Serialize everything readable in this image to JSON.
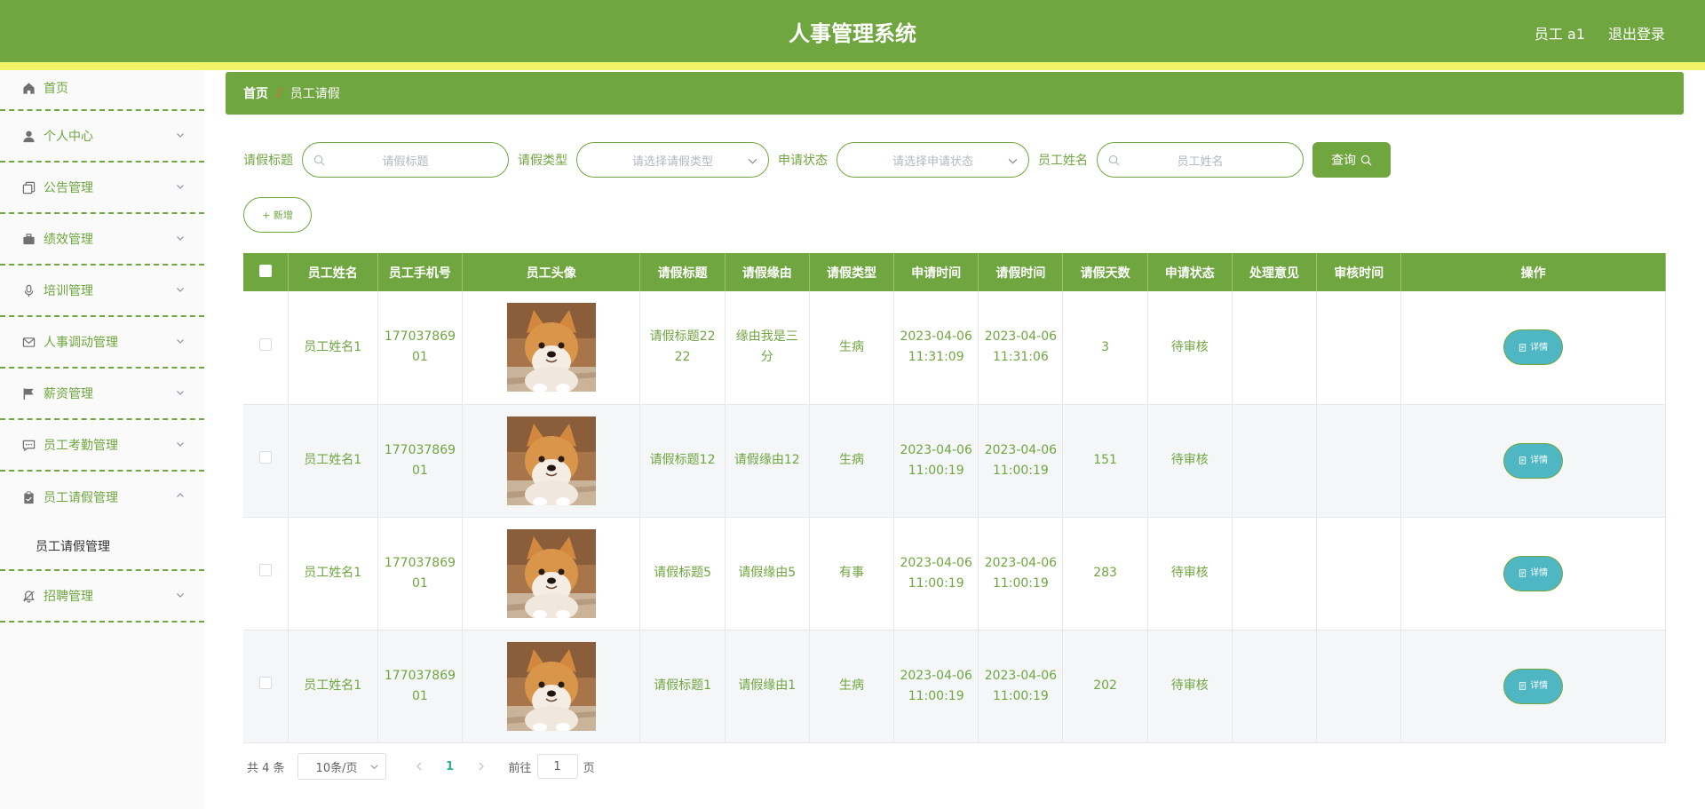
{
  "header": {
    "title": "人事管理系统",
    "user": "员工 a1",
    "logout": "退出登录"
  },
  "sidebar": {
    "items": [
      {
        "label": "首页",
        "icon": "home-icon"
      },
      {
        "label": "个人中心",
        "icon": "user-icon"
      },
      {
        "label": "公告管理",
        "icon": "copy-icon"
      },
      {
        "label": "绩效管理",
        "icon": "briefcase-icon"
      },
      {
        "label": "培训管理",
        "icon": "microphone-icon"
      },
      {
        "label": "人事调动管理",
        "icon": "message-icon"
      },
      {
        "label": "薪资管理",
        "icon": "flag-icon"
      },
      {
        "label": "员工考勤管理",
        "icon": "chat-dots-icon"
      },
      {
        "label": "员工请假管理",
        "icon": "clipboard-icon"
      },
      {
        "label": "招聘管理",
        "icon": "bell-off-icon"
      }
    ],
    "submenu_label": "员工请假管理"
  },
  "breadcrumb": {
    "home": "首页",
    "separator": "/",
    "current": "员工请假"
  },
  "search": {
    "title_label": "请假标题",
    "title_placeholder": "请假标题",
    "type_label": "请假类型",
    "type_placeholder": "请选择请假类型",
    "status_label": "申请状态",
    "status_placeholder": "请选择申请状态",
    "name_label": "员工姓名",
    "name_placeholder": "员工姓名",
    "query_button": "查询"
  },
  "add_button": "+ 新增",
  "table": {
    "columns": [
      "员工姓名",
      "员工手机号",
      "员工头像",
      "请假标题",
      "请假缘由",
      "请假类型",
      "申请时间",
      "请假时间",
      "请假天数",
      "申请状态",
      "处理意见",
      "审核时间",
      "操作"
    ],
    "rows": [
      {
        "name": "员工姓名1",
        "phone": "17703786901",
        "title": "请假标题2222",
        "reason": "缘由我是三分",
        "type": "生病",
        "apply_time": "2023-04-06 11:31:09",
        "leave_time": "2023-04-06 11:31:06",
        "days": "3",
        "status": "待审核",
        "opinion": "",
        "review_time": ""
      },
      {
        "name": "员工姓名1",
        "phone": "17703786901",
        "title": "请假标题12",
        "reason": "请假缘由12",
        "type": "生病",
        "apply_time": "2023-04-06 11:00:19",
        "leave_time": "2023-04-06 11:00:19",
        "days": "151",
        "status": "待审核",
        "opinion": "",
        "review_time": ""
      },
      {
        "name": "员工姓名1",
        "phone": "17703786901",
        "title": "请假标题5",
        "reason": "请假缘由5",
        "type": "有事",
        "apply_time": "2023-04-06 11:00:19",
        "leave_time": "2023-04-06 11:00:19",
        "days": "283",
        "status": "待审核",
        "opinion": "",
        "review_time": ""
      },
      {
        "name": "员工姓名1",
        "phone": "17703786901",
        "title": "请假标题1",
        "reason": "请假缘由1",
        "type": "生病",
        "apply_time": "2023-04-06 11:00:19",
        "leave_time": "2023-04-06 11:00:19",
        "days": "202",
        "status": "待审核",
        "opinion": "",
        "review_time": ""
      }
    ],
    "detail_button": "详情"
  },
  "pagination": {
    "total": "共 4 条",
    "page_size": "10条/页",
    "current_page": "1",
    "goto_label": "前往",
    "goto_value": "1",
    "page_suffix": "页"
  },
  "colors": {
    "primary": "#6fa63f",
    "strip": "#f3f36a",
    "detail_button": "#4fb7c4"
  }
}
